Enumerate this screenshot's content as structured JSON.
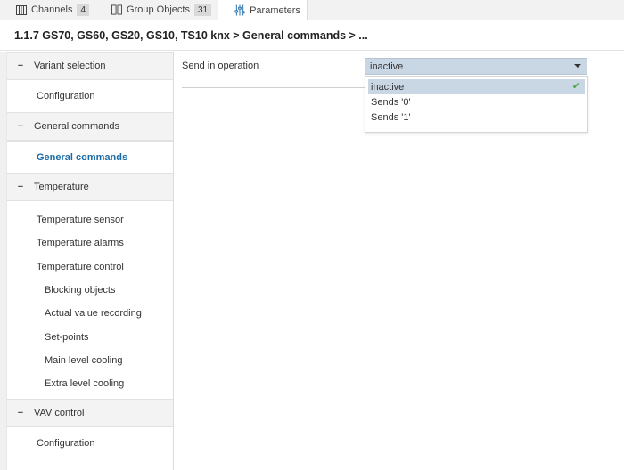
{
  "tabs": [
    {
      "label": "Channels",
      "count": "4",
      "icon": "channels-icon"
    },
    {
      "label": "Group Objects",
      "count": "31",
      "icon": "group-objects-icon"
    },
    {
      "label": "Parameters",
      "icon": "parameters-icon"
    }
  ],
  "breadcrumb": "1.1.7 GS70, GS60, GS20, GS10, TS10 knx > General commands > ...",
  "sidebar": {
    "variant_selection": "Variant selection",
    "configuration_1": "Configuration",
    "general_commands_group": "General commands",
    "general_commands_item": "General commands",
    "temperature": "Temperature",
    "temperature_sensor": "Temperature sensor",
    "temperature_alarms": "Temperature alarms",
    "temperature_control": "Temperature control",
    "blocking_objects": "Blocking objects",
    "actual_value_recording": "Actual value recording",
    "set_points": "Set-points",
    "main_level_cooling": "Main level cooling",
    "extra_level_cooling": "Extra level cooling",
    "vav_control": "VAV control",
    "configuration_2": "Configuration"
  },
  "main": {
    "param_label": "Send in operation",
    "select_value": "inactive",
    "options": [
      "inactive",
      "Sends '0'",
      "Sends '1'"
    ]
  },
  "colors": {
    "accent": "#1a6aa8",
    "select_bg": "#c9d6e3",
    "check": "#4aa84a"
  }
}
